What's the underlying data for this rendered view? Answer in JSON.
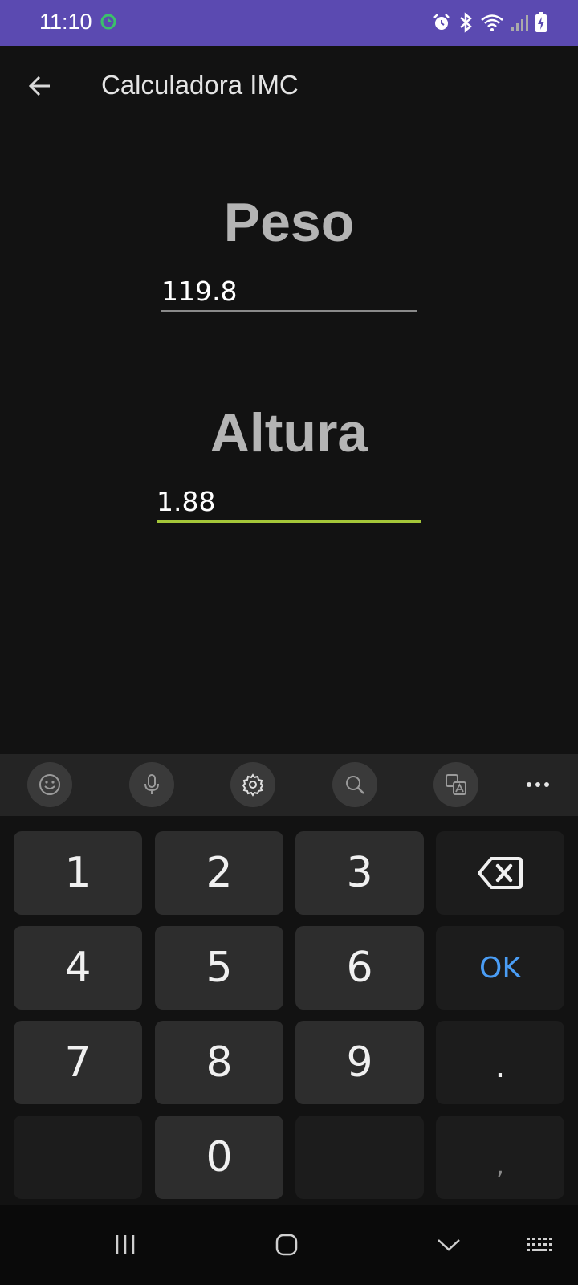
{
  "status_bar": {
    "time": "11:10",
    "icons": [
      "sync-icon",
      "alarm-icon",
      "bluetooth-icon",
      "wifi-icon",
      "signal-icon",
      "battery-charging-icon"
    ]
  },
  "app_bar": {
    "title": "Calculadora IMC",
    "back_icon": "arrow-left-icon"
  },
  "form": {
    "weight": {
      "label": "Peso",
      "value": "119.8"
    },
    "height": {
      "label": "Altura",
      "value": "1.88"
    }
  },
  "colors": {
    "status_bar": "#5b4ab1",
    "background": "#121212",
    "focus_underline": "#a4c639",
    "idle_underline": "#8a8a8a",
    "ok_key": "#4a9df5"
  },
  "keyboard": {
    "toolbar": [
      "emoji-icon",
      "microphone-icon",
      "settings-icon",
      "search-icon",
      "translate-icon",
      "more-icon"
    ],
    "keys": {
      "k1": "1",
      "k2": "2",
      "k3": "3",
      "k4": "4",
      "k5": "5",
      "k6": "6",
      "k7": "7",
      "k8": "8",
      "k9": "9",
      "k0": "0",
      "ok": "OK",
      "dot": ".",
      "comma": ","
    }
  },
  "nav_bar": {
    "icons": [
      "recent-apps-icon",
      "home-icon",
      "back-chevron-icon",
      "keyboard-icon"
    ]
  }
}
